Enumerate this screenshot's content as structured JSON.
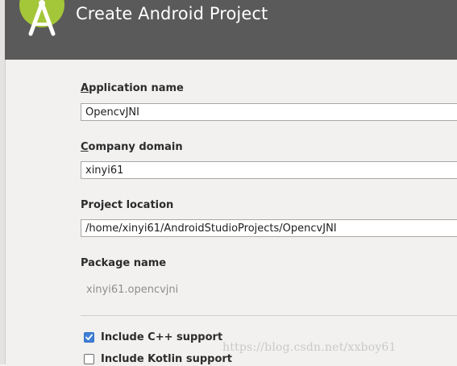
{
  "header": {
    "title": "Create Android Project",
    "logo_icon": "android-studio-icon"
  },
  "form": {
    "application_name": {
      "label_mnemonic": "A",
      "label_rest": "pplication name",
      "value": "OpencvJNI"
    },
    "company_domain": {
      "label_mnemonic": "C",
      "label_rest": "ompany domain",
      "value": "xinyi61"
    },
    "project_location": {
      "label": "Project location",
      "value": "/home/xinyi61/AndroidStudioProjects/OpencvJNI"
    },
    "package_name": {
      "label": "Package name",
      "value": "xinyi61.opencvjni"
    },
    "include_cpp": {
      "label": "Include C++ support",
      "checked": true
    },
    "include_kotlin": {
      "label": "Include Kotlin support",
      "checked": false
    }
  },
  "watermark": "https://blog.csdn.net/xxboy61",
  "colors": {
    "header_bg": "#5a5a5a",
    "checkbox_accent": "#3f7fd6",
    "logo_green": "#a4c639"
  }
}
